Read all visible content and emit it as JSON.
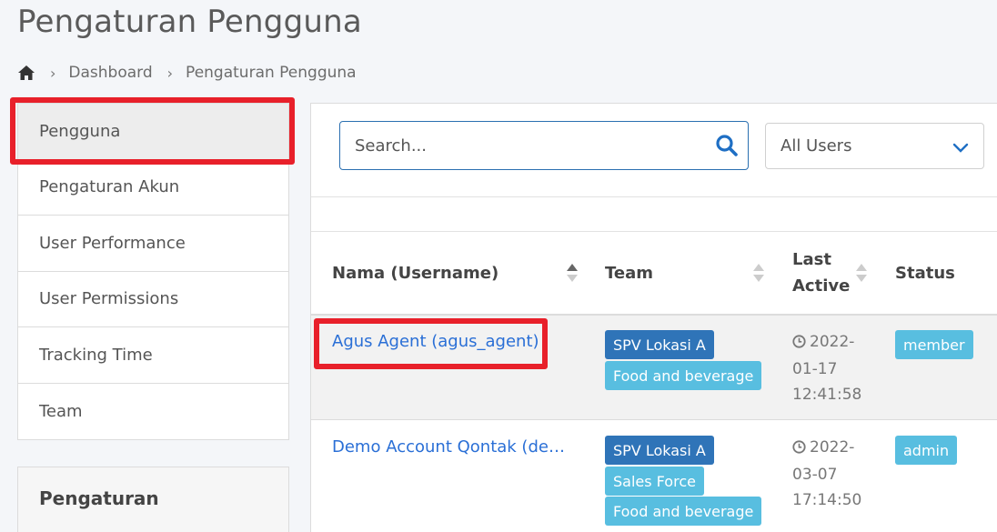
{
  "page": {
    "title": "Pengaturan Pengguna"
  },
  "breadcrumb": {
    "home_icon": "home-icon",
    "items": [
      "Dashboard",
      "Pengaturan Pengguna"
    ]
  },
  "sidebar": {
    "items": [
      {
        "label": "Pengguna",
        "active": true
      },
      {
        "label": "Pengaturan Akun"
      },
      {
        "label": "User Performance"
      },
      {
        "label": "User Permissions"
      },
      {
        "label": "Tracking Time"
      },
      {
        "label": "Team"
      }
    ]
  },
  "settings_card": {
    "title": "Pengaturan"
  },
  "search": {
    "placeholder": "Search...",
    "icon": "search-icon"
  },
  "filter": {
    "selected": "All Users",
    "icon": "chevron-down-icon"
  },
  "table": {
    "headers": {
      "name": "Nama (Username)",
      "team": "Team",
      "last_active_line1": "Last",
      "last_active_line2": "Active",
      "status": "Status"
    },
    "rows": [
      {
        "name": "Agus Agent (agus_agent)",
        "teams": [
          "SPV Lokasi A",
          "Food and beverage"
        ],
        "last_active": [
          "2022-",
          "01-17",
          "12:41:58"
        ],
        "status": "member"
      },
      {
        "name": "Demo Account Qontak (de…",
        "teams": [
          "SPV Lokasi A",
          "Sales Force",
          "Food and beverage"
        ],
        "last_active": [
          "2022-",
          "03-07",
          "17:14:50"
        ],
        "status": "admin"
      }
    ]
  },
  "colors": {
    "accent": "#2a6fd6",
    "badge_dark": "#2f74b8",
    "badge_light": "#58bee0",
    "highlight": "#e8202a"
  }
}
